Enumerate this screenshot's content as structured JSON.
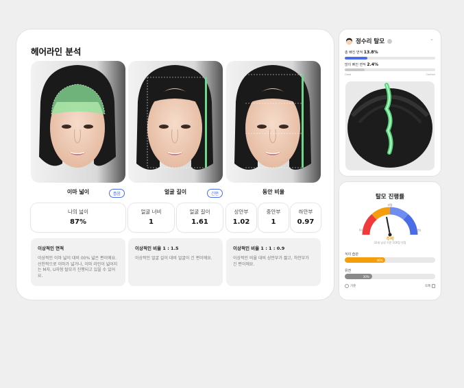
{
  "main": {
    "title": "헤어라인 분석",
    "columns": [
      {
        "label": "이마 넓이",
        "badge": "좁음"
      },
      {
        "label": "얼굴 길이",
        "badge": "긴편"
      },
      {
        "label": "동안 비율",
        "badge": ""
      }
    ],
    "metrics": [
      {
        "label": "나의 넓이",
        "value": "87%"
      },
      {
        "label": "얼굴 너비",
        "value": "1"
      },
      {
        "label": "얼굴 길이",
        "value": "1.61"
      },
      {
        "label": "상안부",
        "value": "1.02"
      },
      {
        "label": "중안부",
        "value": "1"
      },
      {
        "label": "하안부",
        "value": "0.97"
      }
    ],
    "descriptions": [
      {
        "title": "이상적인 면적",
        "text": "이상적인 이마 넓이 대비 00% 넓은 편이에요. 선천적으로 이마가 넓거나, 이마 라인이 넓어지는 M자, U자형 탈모가 진행되고 있을 수 있어요."
      },
      {
        "title": "이상적인 비율 1 : 1.5",
        "text": "이상적인 얼굴 길이 대비 얼굴이 긴 편이에요."
      },
      {
        "title": "이상적인 비율 1 : 1 : 0.9",
        "text": "이상적인 비율 대비 상안부가 짧고, 하안부가 긴 편이에요."
      }
    ]
  },
  "crown": {
    "title": "정수리 탈모",
    "stats": [
      {
        "label": "총 빠진 면적",
        "value": "13.8%",
        "fill": 0.25,
        "color": "#4a6de6"
      },
      {
        "label": "많이 빠진 면적",
        "value": "2.4%",
        "fill": 0.22,
        "color": "#c8c8c8"
      }
    ],
    "scale_left": "Good",
    "scale_right": "Caution"
  },
  "progress": {
    "title": "탈모 진행률",
    "gauge_top": "보통",
    "gauge_left": "주의",
    "gauge_right": "양호",
    "status": "주의",
    "sub": "33세 남성 기준 100점 만점",
    "bars": [
      {
        "label": "식이 습관",
        "value": "36%",
        "fill": 0.45,
        "color": "#f59e0b"
      },
      {
        "label": "유전",
        "value": "30%",
        "fill": 0.3,
        "color": "#8a8a8a"
      }
    ],
    "footer_left": "기준",
    "footer_right": "삭제"
  },
  "colors": {
    "accent": "#4a6de6",
    "warning": "#f59e0b",
    "danger": "#ef3b3b",
    "light_blue": "#6f8cf0"
  }
}
